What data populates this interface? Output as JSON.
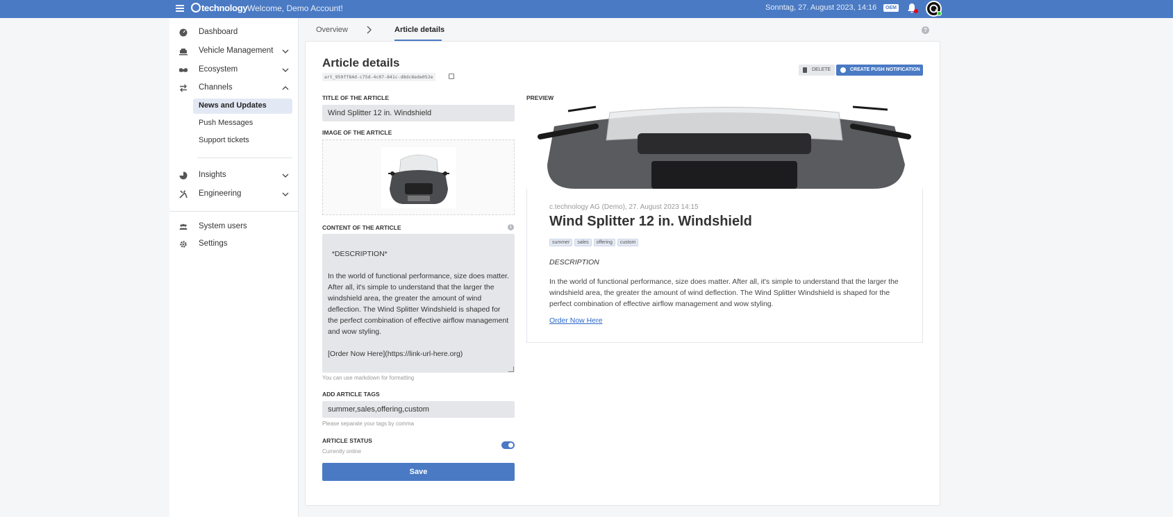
{
  "topbar": {
    "brand": "technology",
    "welcome": "Welcome, Demo Account!",
    "datetime": "Sonntag, 27. August 2023, 14:16",
    "oem_badge": "OEM"
  },
  "sidebar": {
    "items": [
      {
        "label": "Dashboard",
        "icon": "dashboard-icon"
      },
      {
        "label": "Vehicle Management",
        "icon": "vehicle-icon"
      },
      {
        "label": "Ecosystem",
        "icon": "handshake-icon"
      },
      {
        "label": "Channels",
        "icon": "arrows-exchange-icon"
      },
      {
        "label": "Insights",
        "icon": "pie-chart-icon"
      },
      {
        "label": "Engineering",
        "icon": "tools-icon"
      },
      {
        "label": "System users",
        "icon": "users-icon"
      },
      {
        "label": "Settings",
        "icon": "gear-icon"
      }
    ],
    "channels_sub": [
      {
        "label": "News and Updates",
        "active": true
      },
      {
        "label": "Push Messages",
        "active": false
      },
      {
        "label": "Support tickets",
        "active": false
      }
    ]
  },
  "breadcrumb": {
    "overview": "Overview",
    "current": "Article details"
  },
  "article": {
    "heading": "Article details",
    "id": "art_959ff84d-c75d-4c07-841c-d8dc8ede052e",
    "delete_label": "DELETE",
    "push_label": "CREATE PUSH NOTIFICATION",
    "title_label": "TITLE OF THE ARTICLE",
    "title_value": "Wind Splitter 12 in. Windshield",
    "image_label": "IMAGE OF THE ARTICLE",
    "content_label": "CONTENT OF THE ARTICLE",
    "content_value": "*DESCRIPTION*\n\nIn the world of functional performance, size does matter. After all, it's simple to understand that the larger the windshield area, the greater the amount of wind deflection. The Wind Splitter Windshield is shaped for the perfect combination of effective airflow management and wow styling.\n\n[Order Now Here](https://link-url-here.org)",
    "content_hint": "You can use markdown for formatting",
    "tags_label": "ADD ARTICLE TAGS",
    "tags_value": "summer,sales,offering,custom",
    "tags_hint": "Please separate your tags by comma",
    "status_label": "ARTICLE STATUS",
    "status_value": "Currently online",
    "status_on": true,
    "save_label": "Save"
  },
  "preview": {
    "label": "PREVIEW",
    "meta": "c.technology AG (Demo), 27. August 2023 14:15",
    "title": "Wind Splitter 12 in. Windshield",
    "tags": [
      "summer",
      "sales",
      "offering",
      "custom"
    ],
    "description_heading": "DESCRIPTION",
    "body": "In the world of functional performance, size does matter. After all, it's simple to understand that the larger the windshield area, the greater the amount of wind deflection. The Wind Splitter Windshield is shaped for the perfect combination of effective airflow management and wow styling.",
    "link_text": "Order Now Here"
  },
  "colors": {
    "accent": "#4a7ac4",
    "topbar": "#4a7ac4",
    "notification_dot": "#ee1111",
    "online_dot": "#33cc33"
  }
}
